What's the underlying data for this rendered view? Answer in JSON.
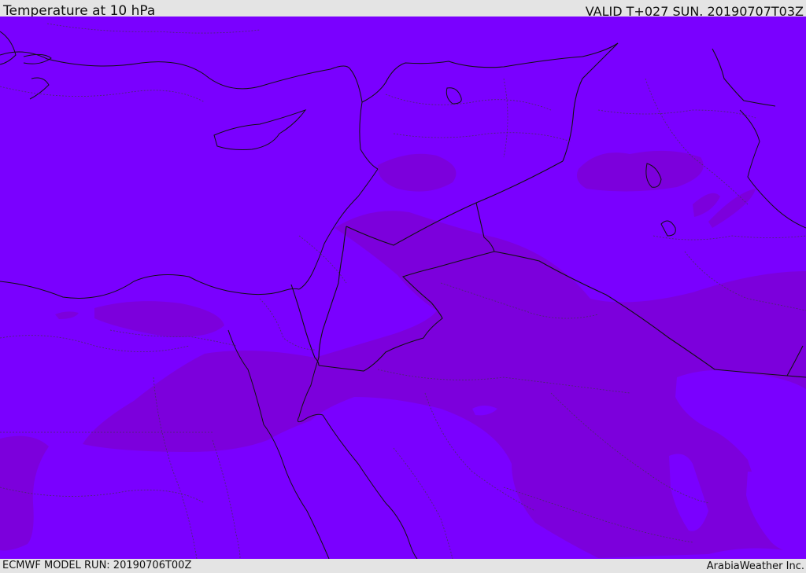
{
  "header": {
    "title": "Temperature at 10 hPa",
    "valid": "VALID T+027 SUN. 20190707T03Z"
  },
  "footer": {
    "model_run": "ECMWF MODEL RUN: 20190706T00Z",
    "credit": "ArabiaWeather Inc."
  },
  "map": {
    "colors": {
      "background_field": "#7a00ff",
      "warm_field": "#7c00dc",
      "coastline": "#111111",
      "border": "#111111",
      "admin_line": "#4a2a6a"
    }
  }
}
